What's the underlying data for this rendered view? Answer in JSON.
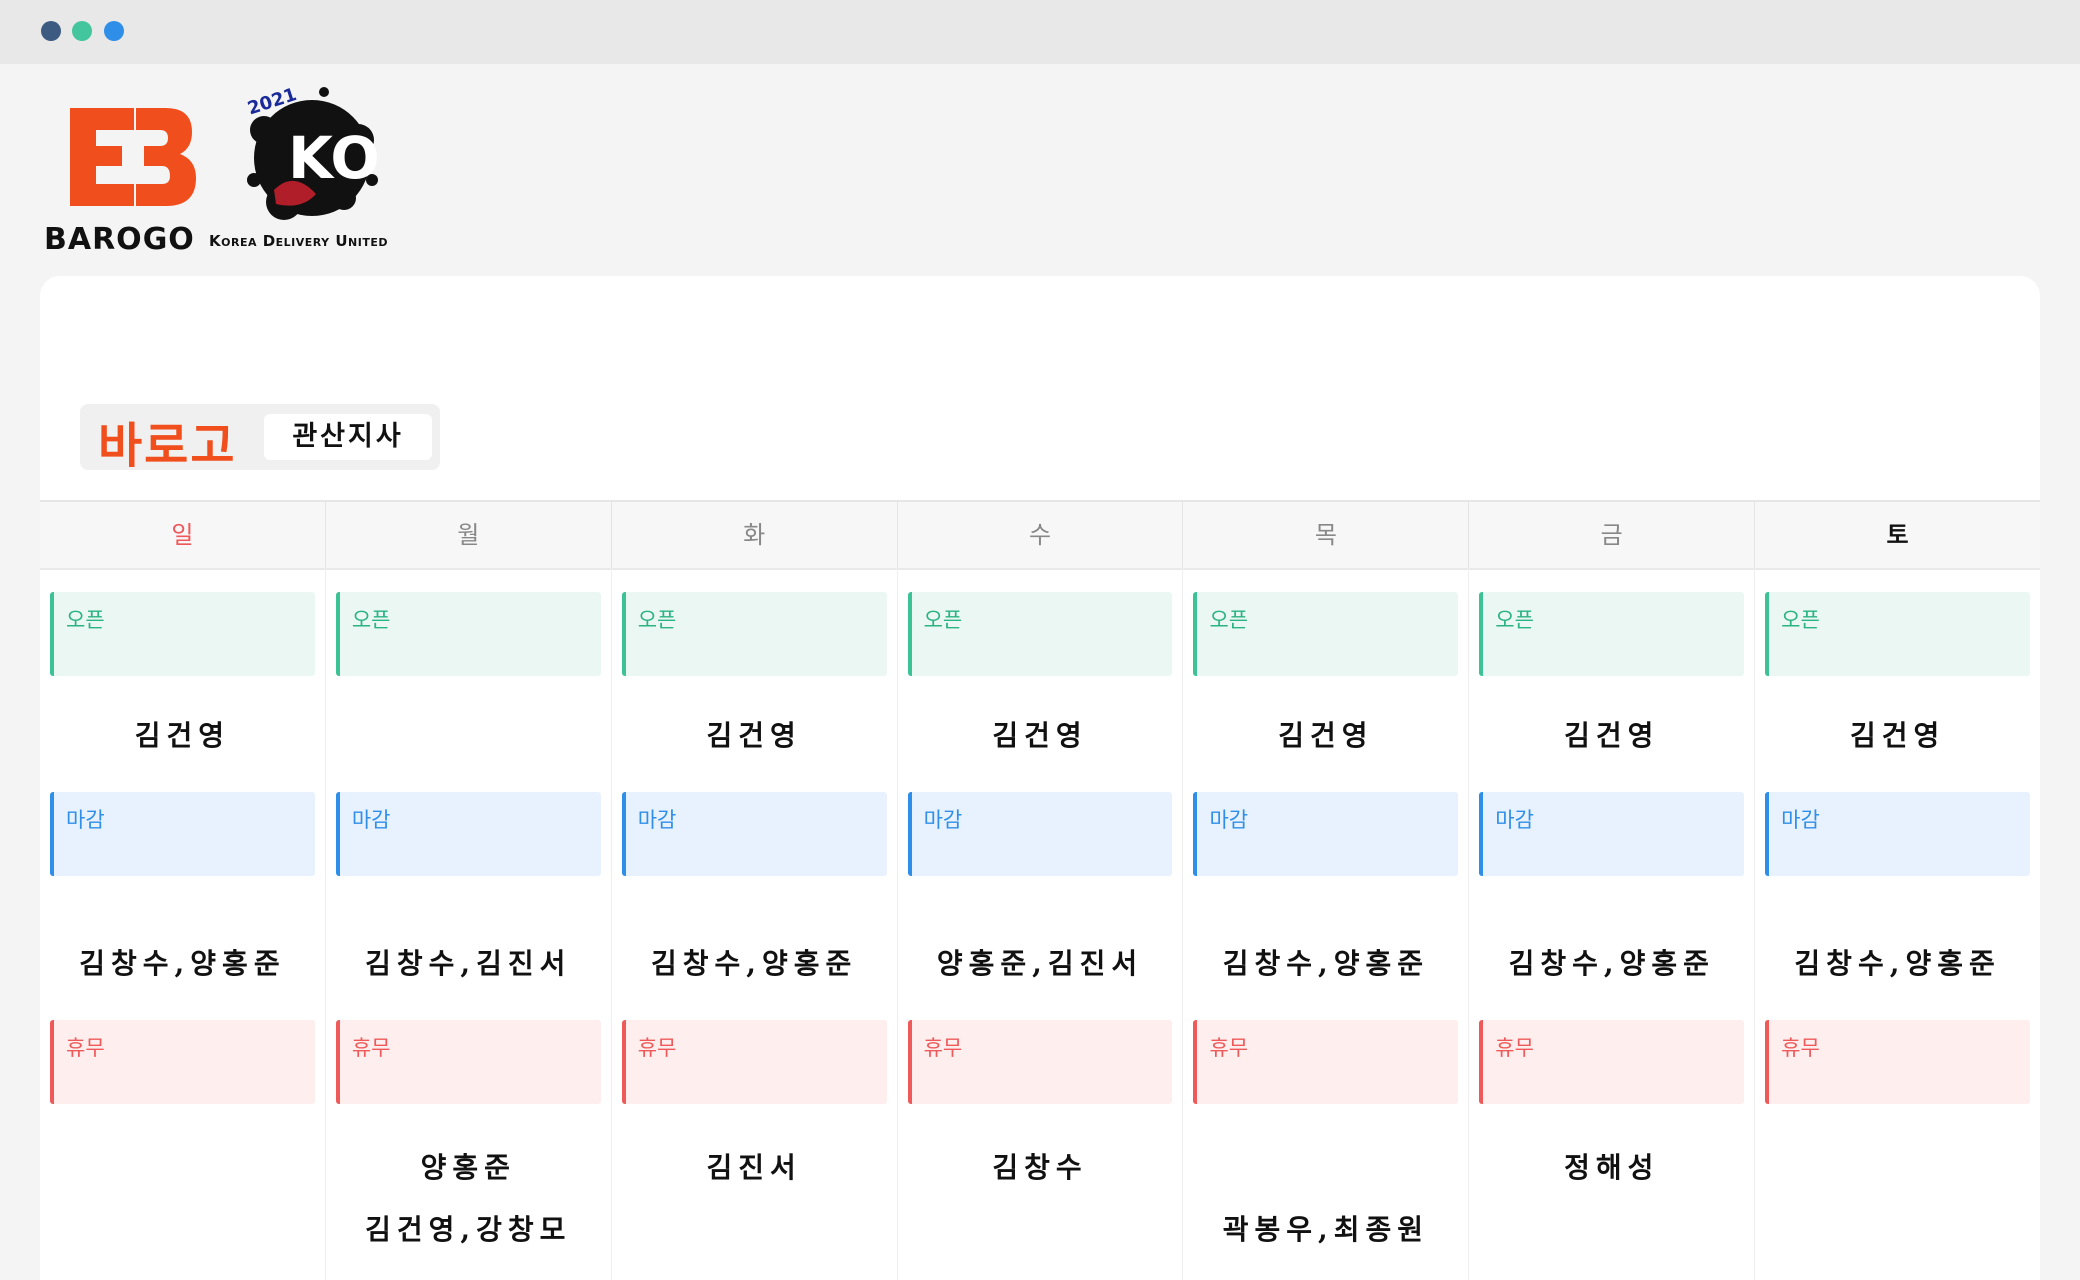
{
  "window": {
    "controls": [
      "close",
      "minimize",
      "maximize"
    ]
  },
  "brand": {
    "logo_name": "BAROGO",
    "logo_subtext": "Korea Delivery United",
    "accent_color": "#f04e1c",
    "emblem_icon": "kdu-grunge-emblem",
    "emblem_text": "KO",
    "emblem_year": "2021"
  },
  "title": {
    "main": "바로고",
    "branch": "관산지사"
  },
  "shift_labels": {
    "open": "오픈",
    "close": "마감",
    "off": "휴무"
  },
  "days": [
    {
      "label": "일",
      "open": "김건영",
      "close": "김창수,양홍준",
      "off1": "",
      "off2": ""
    },
    {
      "label": "월",
      "open": "",
      "close": "김창수,김진서",
      "off1": "양홍준",
      "off2": "김건영,강창모"
    },
    {
      "label": "화",
      "open": "김건영",
      "close": "김창수,양홍준",
      "off1": "김진서",
      "off2": ""
    },
    {
      "label": "수",
      "open": "김건영",
      "close": "양홍준,김진서",
      "off1": "김창수",
      "off2": ""
    },
    {
      "label": "목",
      "open": "김건영",
      "close": "김창수,양홍준",
      "off1": "",
      "off2": "곽봉우,최종원"
    },
    {
      "label": "금",
      "open": "김건영",
      "close": "김창수,양홍준",
      "off1": "정해성",
      "off2": ""
    },
    {
      "label": "토",
      "open": "김건영",
      "close": "김창수,양홍준",
      "off1": "",
      "off2": ""
    }
  ],
  "colors": {
    "open": "#3cc295",
    "close": "#2f8fe8",
    "off": "#ee5a5a",
    "sunday": "#f0565a"
  }
}
